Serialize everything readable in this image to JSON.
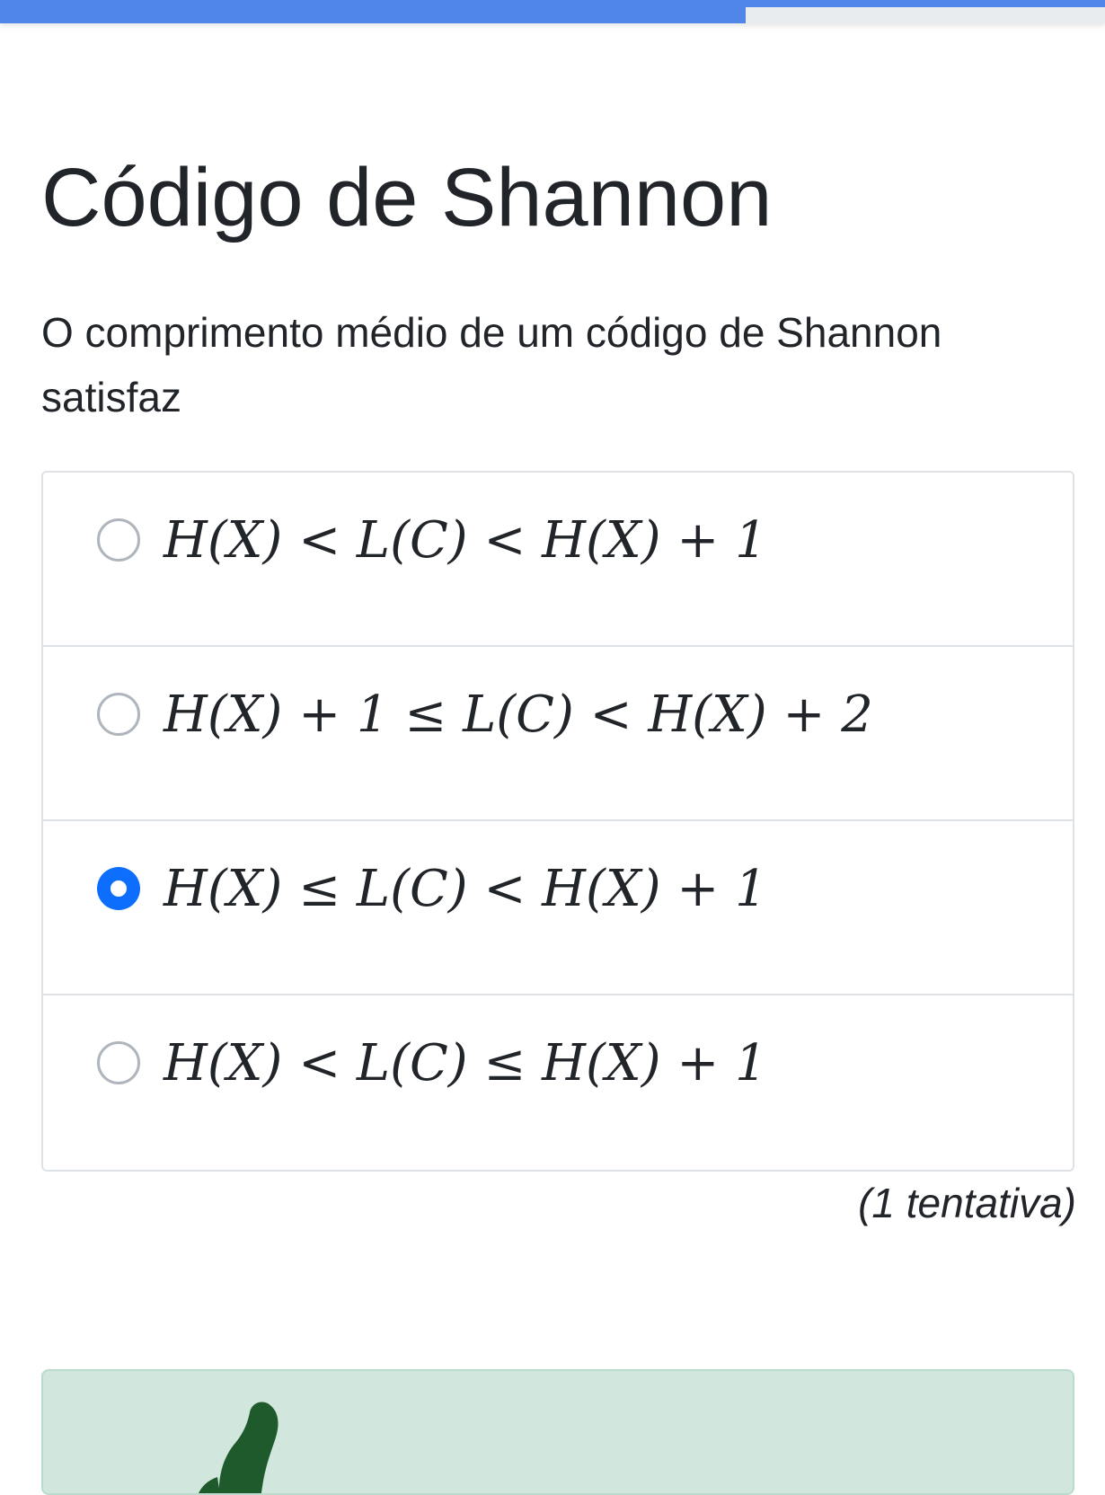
{
  "progress": {
    "fraction": 0.675,
    "color": "#4f86e8"
  },
  "page_title": "Código de Shannon",
  "question": "O comprimento médio de um código de Shannon satisfaz",
  "options": [
    {
      "label": "H(X) < L(C) < H(X) + 1",
      "selected": false
    },
    {
      "label": "H(X) + 1 ≤ L(C) < H(X) + 2",
      "selected": false
    },
    {
      "label": "H(X) ≤ L(C) < H(X) + 1",
      "selected": true
    },
    {
      "label": "H(X) < L(C) ≤ H(X) + 1",
      "selected": false
    }
  ],
  "attempts": "(1 tentativa)",
  "feedback": {
    "icon": "thumbs-up-icon",
    "background": "#d1e7dd",
    "icon_color": "#1e5a2c"
  },
  "colors": {
    "radio_selected": "#0d6efd",
    "radio_border": "#aeb5bc"
  }
}
